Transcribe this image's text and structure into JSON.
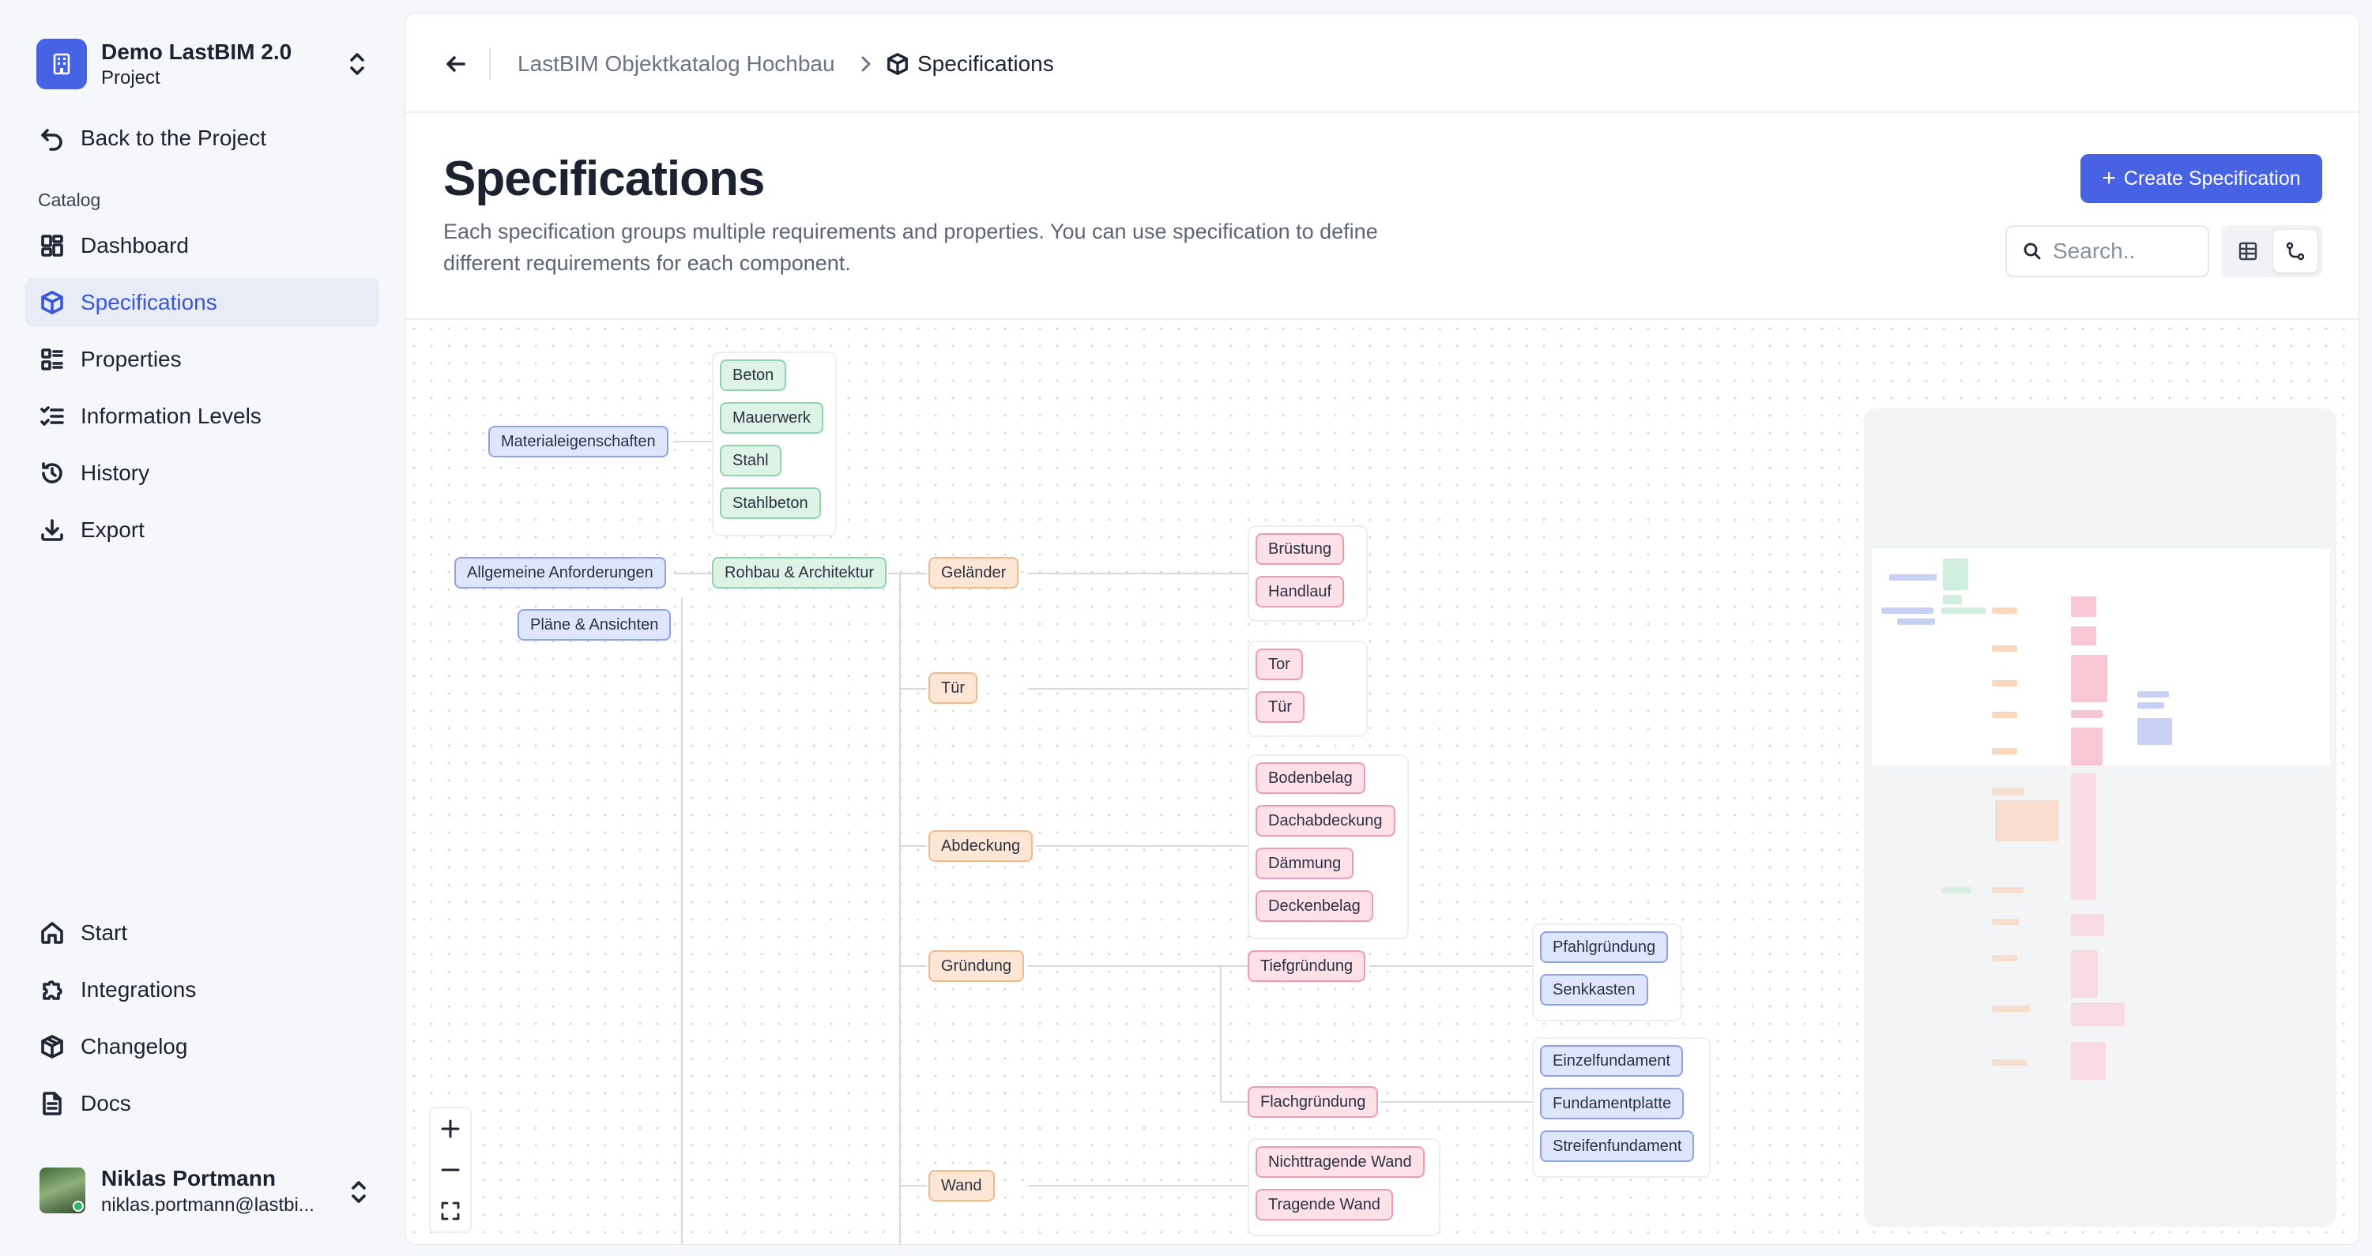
{
  "project": {
    "name": "Demo LastBIM 2.0",
    "subtitle": "Project"
  },
  "sidebar": {
    "back_label": "Back to the Project",
    "catalog_label": "Catalog",
    "items": [
      {
        "label": "Dashboard",
        "icon": "dashboard-icon"
      },
      {
        "label": "Specifications",
        "icon": "cube-icon",
        "active": true
      },
      {
        "label": "Properties",
        "icon": "properties-icon"
      },
      {
        "label": "Information Levels",
        "icon": "checklist-icon"
      },
      {
        "label": "History",
        "icon": "history-icon"
      },
      {
        "label": "Export",
        "icon": "download-icon"
      }
    ],
    "bottom_items": [
      {
        "label": "Start",
        "icon": "home-icon"
      },
      {
        "label": "Integrations",
        "icon": "puzzle-icon"
      },
      {
        "label": "Changelog",
        "icon": "package-icon"
      },
      {
        "label": "Docs",
        "icon": "document-icon"
      }
    ],
    "user": {
      "name": "Niklas Portmann",
      "email": "niklas.portmann@lastbi..."
    }
  },
  "breadcrumb": {
    "parent": "LastBIM Objektkatalog Hochbau",
    "current": "Specifications"
  },
  "header": {
    "title": "Specifications",
    "description": "Each specification groups multiple requirements and properties. You can use specification to define different requirements for each component.",
    "create_label": "Create Specification",
    "search_placeholder": "Search.."
  },
  "graph": {
    "nodes": {
      "materialeigenschaften": "Materialeigenschaften",
      "beton": "Beton",
      "mauerwerk": "Mauerwerk",
      "stahl": "Stahl",
      "stahlbeton": "Stahlbeton",
      "allgemeine": "Allgemeine Anforderungen",
      "plaene": "Pläne & Ansichten",
      "rohbau": "Rohbau & Architektur",
      "gelaender": "Geländer",
      "bruestung": "Brüstung",
      "handlauf": "Handlauf",
      "tuer": "Tür",
      "tor": "Tor",
      "tuer2": "Tür",
      "abdeckung": "Abdeckung",
      "bodenbelag": "Bodenbelag",
      "dachabdeckung": "Dachabdeckung",
      "daemmung": "Dämmung",
      "deckenbelag": "Deckenbelag",
      "gruendung": "Gründung",
      "tiefgruendung": "Tiefgründung",
      "pfahlgruendung": "Pfahlgründung",
      "senkkasten": "Senkkasten",
      "flachgruendung": "Flachgründung",
      "einzelfundament": "Einzelfundament",
      "fundamentplatte": "Fundamentplatte",
      "streifenfundament": "Streifenfundament",
      "wand": "Wand",
      "nichttragende": "Nichttragende Wand",
      "tragende": "Tragende Wand"
    }
  },
  "colors": {
    "accent": "#4763e4",
    "blue_node": "#dfe5fa",
    "green_node": "#dcf3e6",
    "orange_node": "#fde6d3",
    "pink_node": "#fde0e8"
  }
}
